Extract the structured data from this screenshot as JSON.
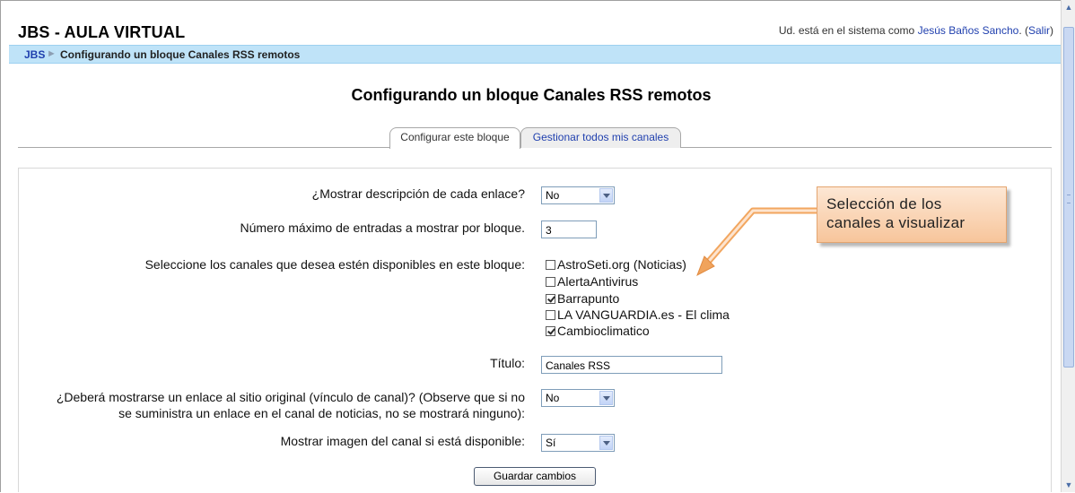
{
  "header": {
    "site_title": "JBS - AULA VIRTUAL",
    "login_prefix": "Ud. está en el sistema como ",
    "user_name": "Jesús Baños Sancho",
    "logout_open": ". (",
    "logout_label": "Salir",
    "logout_close": ")"
  },
  "breadcrumb": {
    "home": "JBS",
    "separator": "►",
    "current": "Configurando un bloque Canales RSS remotos"
  },
  "page_title": "Configurando un bloque Canales RSS remotos",
  "tabs": [
    {
      "label": "Configurar este bloque",
      "active": true
    },
    {
      "label": "Gestionar todos mis canales",
      "active": false
    }
  ],
  "form": {
    "show_description": {
      "label": "¿Mostrar descripción de cada enlace?",
      "value": "No"
    },
    "max_entries": {
      "label": "Número máximo de entradas a mostrar por bloque.",
      "value": "3"
    },
    "channels": {
      "label": "Seleccione los canales que desea estén disponibles en este bloque:",
      "options": [
        {
          "label": "AstroSeti.org (Noticias)",
          "checked": false
        },
        {
          "label": "AlertaAntivirus",
          "checked": false
        },
        {
          "label": "Barrapunto",
          "checked": true
        },
        {
          "label": "LA VANGUARDIA.es - El clima",
          "checked": false
        },
        {
          "label": "Cambioclimatico",
          "checked": true
        }
      ]
    },
    "title": {
      "label": "Título:",
      "value": "Canales RSS"
    },
    "show_link": {
      "label_line1": "¿Deberá mostrarse un enlace al sitio original (vínculo de canal)? (Observe que si no",
      "label_line2": "se suministra un enlace en el canal de noticias, no se mostrará ninguno):",
      "value": "No"
    },
    "show_image": {
      "label": "Mostrar imagen del canal si está disponible:",
      "value": "Sí"
    },
    "save_label": "Guardar cambios"
  },
  "callout": {
    "line1": "Selección de los",
    "line2": "canales a visualizar"
  },
  "colors": {
    "navbar_bg": "#bfe3f8",
    "link": "#1f3fae",
    "callout_bg": "#f7c59b"
  }
}
